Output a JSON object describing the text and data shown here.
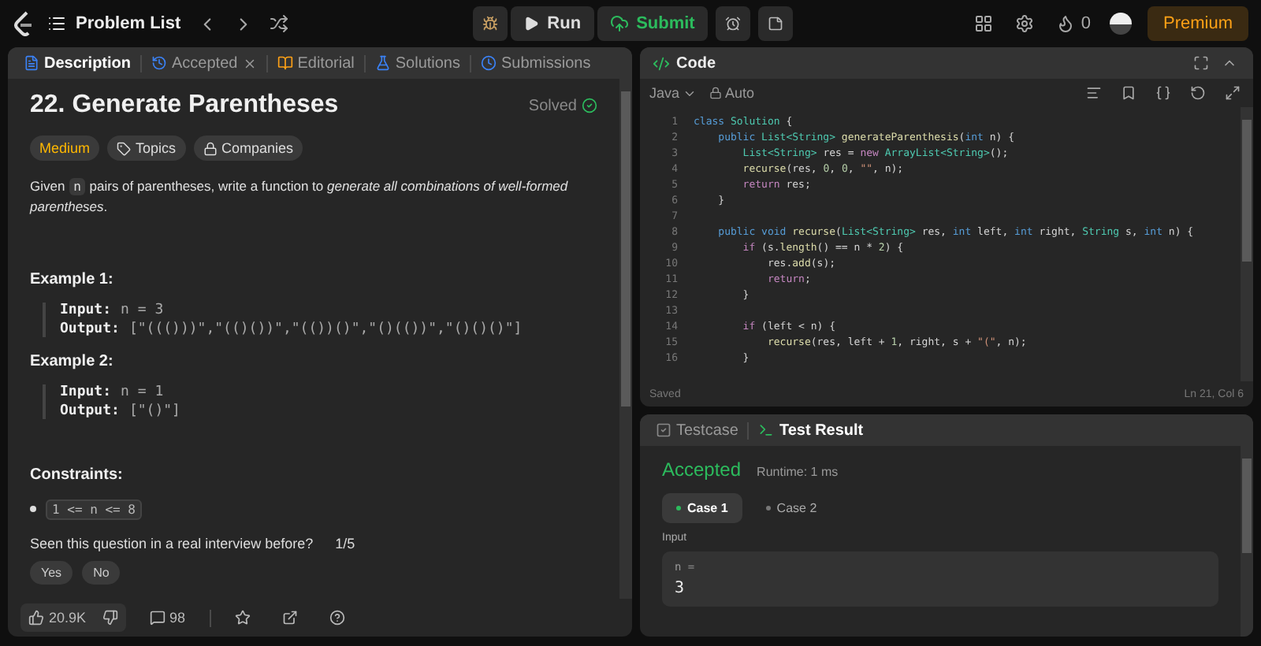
{
  "topbar": {
    "nav_title": "Problem List",
    "run": "Run",
    "submit": "Submit",
    "streak": "0",
    "premium": "Premium"
  },
  "left_tabs": [
    {
      "label": "Description",
      "selected": true,
      "closable": false
    },
    {
      "label": "Accepted",
      "selected": false,
      "closable": true
    },
    {
      "label": "Editorial",
      "selected": false,
      "closable": false
    },
    {
      "label": "Solutions",
      "selected": false,
      "closable": false
    },
    {
      "label": "Submissions",
      "selected": false,
      "closable": false
    }
  ],
  "problem": {
    "title": "22. Generate Parentheses",
    "status": "Solved",
    "tags": [
      {
        "label": "Medium",
        "kind": "difficulty"
      },
      {
        "label": "Topics",
        "kind": "topics"
      },
      {
        "label": "Companies",
        "kind": "companies"
      }
    ],
    "description": {
      "before": "Given ",
      "code": "n",
      "after": " pairs of parentheses, write a function to *generate all combinations of well-formed parentheses*."
    },
    "examples": [
      {
        "title": "Example 1:",
        "input_label": "Input:",
        "input": "n = 3",
        "output_label": "Output:",
        "output": "[\"((()))\",\"(()())\",\"(())()\",\"()(())\",\"()()()\"]"
      },
      {
        "title": "Example 2:",
        "input_label": "Input:",
        "input": "n = 1",
        "output_label": "Output:",
        "output": "[\"()\"]"
      }
    ],
    "constraints_title": "Constraints:",
    "constraints": [
      "1 <= n <= 8"
    ],
    "interview": {
      "question": "Seen this question in a real interview before?",
      "count": "1/5",
      "answers": [
        "Yes",
        "No"
      ]
    }
  },
  "footer": {
    "likes": "20.9K",
    "comments": "98"
  },
  "code": {
    "title": "Code",
    "language": "Java",
    "mode": "Auto",
    "status": "Saved",
    "position": "Ln 21, Col 6",
    "lines": [
      {
        "number": "1",
        "tokens": [
          {
            "kind": "kw",
            "text": "class"
          },
          {
            "kind": "ty",
            "text": " Solution"
          },
          {
            "kind": "p",
            "text": " {"
          }
        ]
      },
      {
        "number": "2",
        "tokens": [
          {
            "kind": "kw",
            "text": "    public"
          },
          {
            "kind": "ty",
            "text": " List<String>"
          },
          {
            "kind": "fn",
            "text": " generateParenthesis"
          },
          {
            "kind": "p",
            "text": "("
          },
          {
            "kind": "kw",
            "text": "int"
          },
          {
            "kind": "p",
            "text": " n) {"
          }
        ]
      },
      {
        "number": "3",
        "tokens": [
          {
            "kind": "ty",
            "text": "        List<String>"
          },
          {
            "kind": "p",
            "text": " res = "
          },
          {
            "kind": "ctl",
            "text": "new"
          },
          {
            "kind": "ty",
            "text": " ArrayList<String>"
          },
          {
            "kind": "p",
            "text": "();"
          }
        ]
      },
      {
        "number": "4",
        "tokens": [
          {
            "kind": "fn",
            "text": "        recurse"
          },
          {
            "kind": "p",
            "text": "(res, "
          },
          {
            "kind": "num",
            "text": "0"
          },
          {
            "kind": "p",
            "text": ", "
          },
          {
            "kind": "num",
            "text": "0"
          },
          {
            "kind": "p",
            "text": ", "
          },
          {
            "kind": "str",
            "text": "\"\""
          },
          {
            "kind": "p",
            "text": ", n);"
          }
        ]
      },
      {
        "number": "5",
        "tokens": [
          {
            "kind": "ctl",
            "text": "        return"
          },
          {
            "kind": "p",
            "text": " res;"
          }
        ]
      },
      {
        "number": "6",
        "tokens": [
          {
            "kind": "p",
            "text": "    }"
          }
        ]
      },
      {
        "number": "7"
      },
      {
        "number": "8",
        "tokens": [
          {
            "kind": "kw",
            "text": "    public void"
          },
          {
            "kind": "fn",
            "text": " recurse"
          },
          {
            "kind": "p",
            "text": "("
          },
          {
            "kind": "ty",
            "text": "List<String>"
          },
          {
            "kind": "p",
            "text": " res, "
          },
          {
            "kind": "kw",
            "text": "int"
          },
          {
            "kind": "p",
            "text": " left, "
          },
          {
            "kind": "kw",
            "text": "int"
          },
          {
            "kind": "p",
            "text": " right, "
          },
          {
            "kind": "ty",
            "text": "String"
          },
          {
            "kind": "p",
            "text": " s, "
          },
          {
            "kind": "kw",
            "text": "int"
          },
          {
            "kind": "p",
            "text": " n) {"
          }
        ]
      },
      {
        "number": "9",
        "tokens": [
          {
            "kind": "ctl",
            "text": "        if"
          },
          {
            "kind": "p",
            "text": " (s."
          },
          {
            "kind": "fn",
            "text": "length"
          },
          {
            "kind": "p",
            "text": "() == n * "
          },
          {
            "kind": "num",
            "text": "2"
          },
          {
            "kind": "p",
            "text": ") {"
          }
        ]
      },
      {
        "number": "10",
        "tokens": [
          {
            "kind": "p",
            "text": "            res."
          },
          {
            "kind": "fn",
            "text": "add"
          },
          {
            "kind": "p",
            "text": "(s);"
          }
        ]
      },
      {
        "number": "11",
        "tokens": [
          {
            "kind": "ctl",
            "text": "            return"
          },
          {
            "kind": "p",
            "text": ";"
          }
        ]
      },
      {
        "number": "12",
        "tokens": [
          {
            "kind": "p",
            "text": "        }"
          }
        ]
      },
      {
        "number": "13"
      },
      {
        "number": "14",
        "tokens": [
          {
            "kind": "ctl",
            "text": "        if"
          },
          {
            "kind": "p",
            "text": " (left < n) {"
          }
        ]
      },
      {
        "number": "15",
        "tokens": [
          {
            "kind": "fn",
            "text": "            recurse"
          },
          {
            "kind": "p",
            "text": "(res, left + "
          },
          {
            "kind": "num",
            "text": "1"
          },
          {
            "kind": "p",
            "text": ", right, s + "
          },
          {
            "kind": "str",
            "text": "\"(\""
          },
          {
            "kind": "p",
            "text": ", n);"
          }
        ]
      },
      {
        "number": "16",
        "tokens": [
          {
            "kind": "p",
            "text": "        }"
          }
        ]
      }
    ]
  },
  "result": {
    "tabs": [
      {
        "label": "Testcase",
        "selected": false
      },
      {
        "label": "Test Result",
        "selected": true
      }
    ],
    "verdict": "Accepted",
    "runtime": "Runtime: 1 ms",
    "cases": [
      {
        "label": "Case 1",
        "selected": true
      },
      {
        "label": "Case 2",
        "selected": false
      }
    ],
    "input_label": "Input",
    "params": [
      {
        "name": "n =",
        "value": "3"
      }
    ]
  }
}
